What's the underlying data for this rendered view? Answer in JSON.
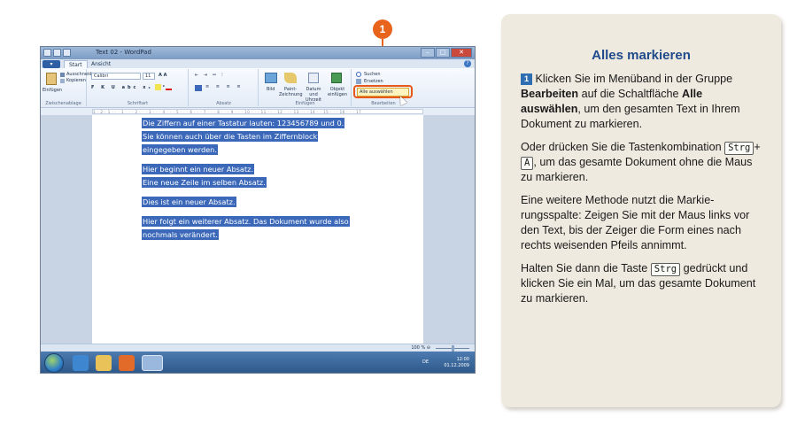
{
  "window": {
    "title": "Text 02 - WordPad",
    "tabs": [
      "Start",
      "Ansicht"
    ],
    "help": "?"
  },
  "ribbon": {
    "clipboard": {
      "paste": "Einfügen",
      "cut": "Ausschneiden",
      "copy": "Kopieren",
      "group": "Zwischenablage"
    },
    "font": {
      "name": "Calibri",
      "size": "11",
      "group": "Schriftart"
    },
    "paragraph": {
      "group": "Absatz"
    },
    "insert": {
      "picture": "Bild",
      "paint": "Paint-Zeichnung",
      "datetime": "Datum und Uhrzeit",
      "object": "Objekt einfügen",
      "group": "Einfügen"
    },
    "edit": {
      "find": "Suchen",
      "replace": "Ersetzen",
      "select_all": "Alle auswählen",
      "group": "Bearbeiten"
    }
  },
  "ruler": "3 · 2 · 1 · · · 1 · · · 2 · · · 3 · · · 4 · · · 5 · · · 6 · · · 7 · · · 8 · · · 9 · · · 10 · · · 11 · · · 12 · · · 13 · · · 14 · · 15 · · · 16 · · · 17",
  "document": {
    "lines": [
      "Die Ziffern auf einer Tastatur lauten: 123456789 und 0.",
      "Sie können auch über die Tasten im Ziffernblock",
      "eingegeben werden.",
      "Hier beginnt ein neuer Absatz.",
      "Eine neue Zeile im selben Absatz.",
      "Dies ist ein neuer Absatz.",
      "Hier folgt ein weiterer Absatz. Das Dokument wurde also",
      "nochmals verändert."
    ]
  },
  "status": {
    "zoom": "100 %",
    "minus": "⊖",
    "plus": "⊕"
  },
  "taskbar": {
    "lang": "DE",
    "time": "12:00",
    "date": "01.12.2009"
  },
  "callout_number": "1",
  "info": {
    "title": "Alles markieren",
    "step": "1",
    "p1_a": "Klicken Sie im Menüband in der Gruppe ",
    "p1_b": "Bearbeiten",
    "p1_c": " auf die Schaltfläche ",
    "p1_d": "Alle auswählen",
    "p1_e": ", um den gesamten Text in Ihrem Dokument zu markieren.",
    "p2_a": "Oder drücken Sie die Tastenkombination ",
    "key_strg": "Strg",
    "plus": "+",
    "key_a": "A",
    "p2_b": ", um das gesamte Dokument ohne die Maus zu markieren.",
    "p3": "Eine weitere Methode nutzt die Markie-rungsspalte: Zeigen Sie mit der Maus links vor den Text, bis der Zeiger die Form eines nach rechts weisenden Pfeils annimmt.",
    "p4_a": "Halten Sie dann die Taste ",
    "p4_b": " gedrückt und klicken Sie ein Mal, um das gesamte Dokument zu markieren."
  }
}
